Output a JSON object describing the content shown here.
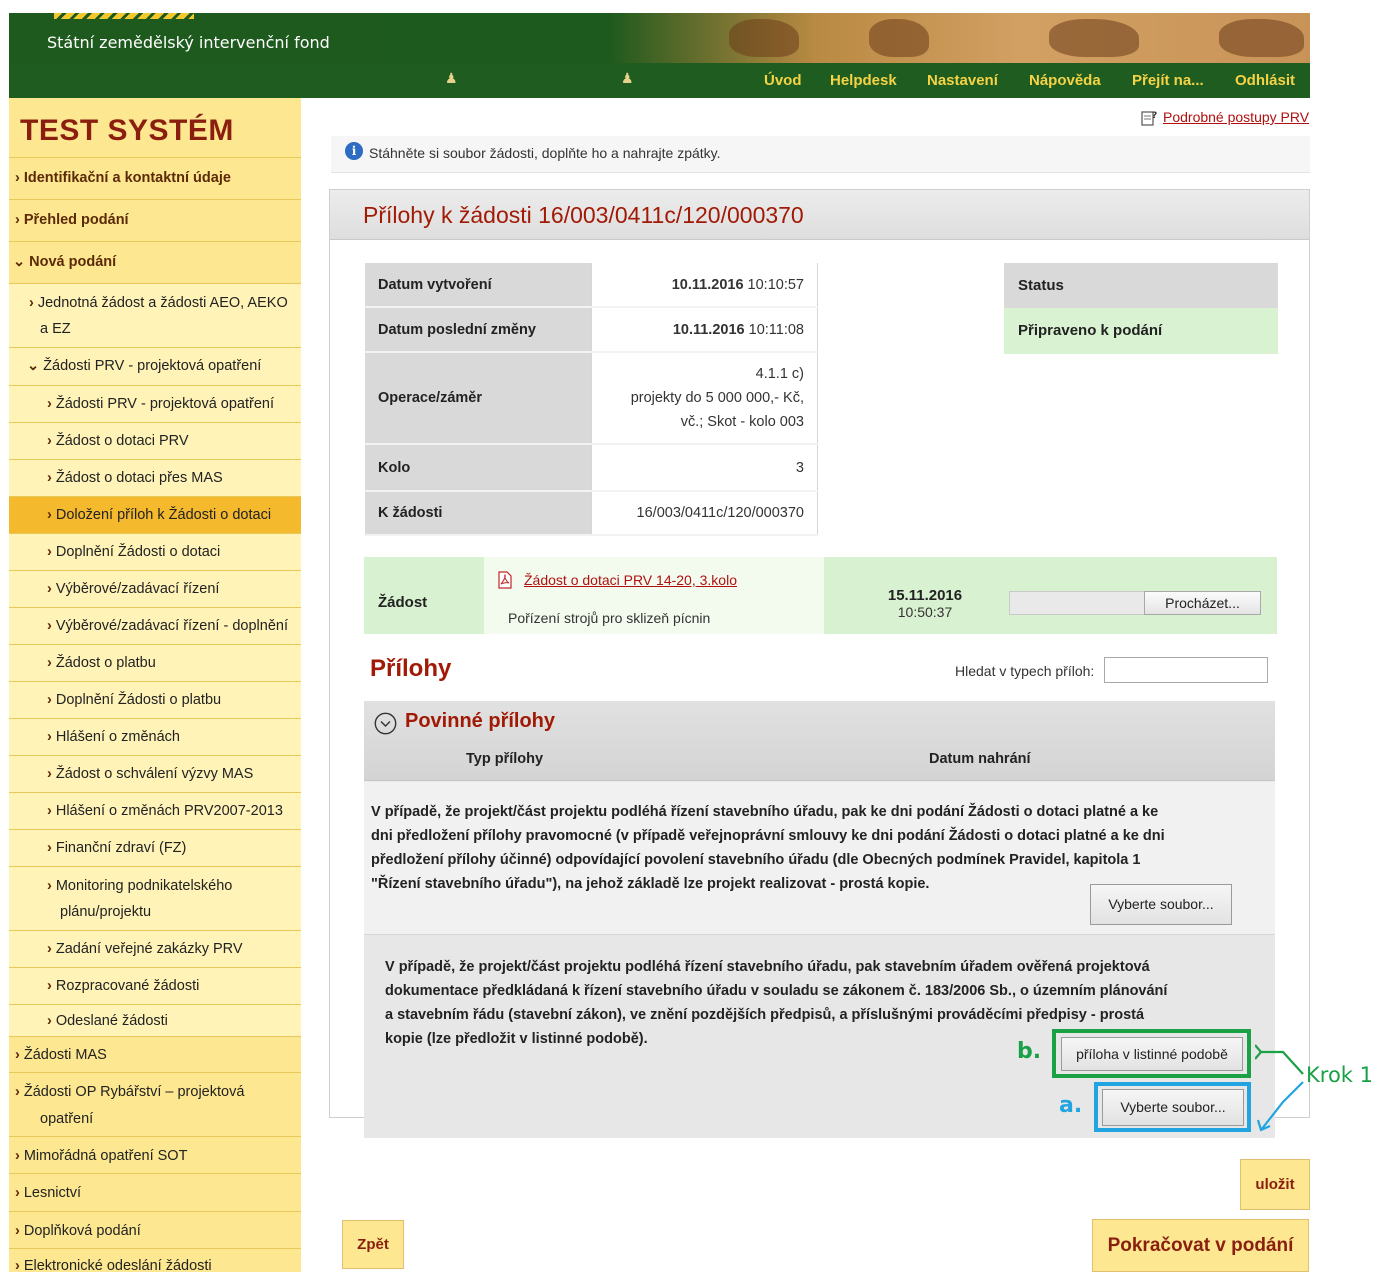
{
  "header": {
    "logo_subtitle": "Státní zemědělský intervenční fond",
    "nav": [
      "Úvod",
      "Helpdesk",
      "Nastavení",
      "Nápověda",
      "Přejít na...",
      "Odhlásit"
    ]
  },
  "sidebar": {
    "system_title": "TEST SYSTÉM",
    "items": [
      {
        "label": "Identifikační a kontaktní údaje"
      },
      {
        "label": "Přehled podání"
      },
      {
        "label": "Nová podání"
      },
      {
        "label_line1": "Jednotná žádost a žádosti AEO, AEKO",
        "label_line2": "a EZ"
      },
      {
        "label": "Žádosti PRV - projektová opatření"
      },
      {
        "label": "Žádosti PRV - projektová opatření"
      },
      {
        "label": "Žádost o dotaci PRV"
      },
      {
        "label": "Žádost o dotaci přes MAS"
      },
      {
        "label": "Doložení příloh k Žádosti o dotaci"
      },
      {
        "label": "Doplnění Žádosti o dotaci"
      },
      {
        "label": "Výběrové/zadávací řízení"
      },
      {
        "label": "Výběrové/zadávací řízení - doplnění"
      },
      {
        "label": "Žádost o platbu"
      },
      {
        "label": "Doplnění Žádosti o platbu"
      },
      {
        "label": "Hlášení o změnách"
      },
      {
        "label": "Žádost o schválení výzvy MAS"
      },
      {
        "label": "Hlášení o změnách PRV2007-2013"
      },
      {
        "label": "Finanční zdraví (FZ)"
      },
      {
        "label_line1": "Monitoring podnikatelského",
        "label_line2": "plánu/projektu"
      },
      {
        "label": "Zadání veřejné zakázky PRV"
      },
      {
        "label": "Rozpracované žádosti"
      },
      {
        "label": "Odeslané žádosti"
      },
      {
        "label": "Žádosti MAS"
      },
      {
        "label_line1": "Žádosti OP Rybářství – projektová",
        "label_line2": "opatření"
      },
      {
        "label": "Mimořádná opatření SOT"
      },
      {
        "label": "Lesnictví"
      },
      {
        "label": "Doplňková podání"
      },
      {
        "label": "Elektronické odeslání žádosti"
      }
    ]
  },
  "help_link": "Podrobné postupy PRV",
  "info_message": "Stáhněte si soubor žádosti, doplňte ho a nahrajte zpátky.",
  "panel_title": "Přílohy k žádosti 16/003/0411c/120/000370",
  "details": {
    "created_label": "Datum vytvoření",
    "created_date": "10.11.2016",
    "created_time": "10:10:57",
    "changed_label": "Datum poslední změny",
    "changed_date": "10.11.2016",
    "changed_time": "10:11:08",
    "operation_label": "Operace/záměr",
    "operation_l1": "4.1.1 c)",
    "operation_l2": "projekty do 5 000 000,- Kč,",
    "operation_l3": "vč.; Skot - kolo 003",
    "round_label": "Kolo",
    "round_value": "3",
    "request_label": "K žádosti",
    "request_value": "16/003/0411c/120/000370"
  },
  "status": {
    "label": "Status",
    "value": "Připraveno k podání"
  },
  "zadost": {
    "label": "Žádost",
    "file_link": "Žádost o dotaci PRV 14-20, 3.kolo",
    "description": "Pořízení strojů pro sklizeň pícnin",
    "date": "15.11.2016",
    "time": "10:50:37",
    "browse_label": "Procházet..."
  },
  "attachments": {
    "title": "Přílohy",
    "search_label": "Hledat v typech příloh:",
    "search_value": "",
    "section_title": "Povinné přílohy",
    "col_type": "Typ přílohy",
    "col_date": "Datum nahrání",
    "row1": {
      "l1": "V případě, že projekt/část projektu podléhá řízení stavebního úřadu, pak ke dni podání Žádosti o dotaci platné a ke",
      "l2": "dni předložení přílohy pravomocné (v případě veřejnoprávní smlouvy ke dni podání Žádosti o dotaci platné a ke dni",
      "l3": "předložení přílohy účinné) odpovídající povolení stavebního úřadu (dle Obecných podmínek Pravidel, kapitola 1",
      "l4": "\"Řízení stavebního úřadu\"), na jehož základě lze projekt realizovat - prostá kopie.",
      "button": "Vyberte soubor..."
    },
    "row2": {
      "l1": "V případě, že projekt/část projektu podléhá řízení stavebního úřadu, pak stavebním úřadem ověřená projektová",
      "l2": "dokumentace předkládaná k řízení stavebního úřadu v souladu se zákonem č. 183/2006 Sb., o územním plánování",
      "l3": "a stavebním řádu (stavební zákon), ve znění pozdějších předpisů, a příslušnými prováděcími předpisy - prostá",
      "l4": "kopie (lze předložit v listinné podobě).",
      "paper_button": "příloha v listinné podobě",
      "file_button": "Vyberte soubor..."
    }
  },
  "annotations": {
    "label_a": "a.",
    "label_b": "b.",
    "step": "Krok 1",
    "color_a": "#22a4e0",
    "color_b": "#1aa145"
  },
  "footer": {
    "save": "uložit",
    "back": "Zpět",
    "continue": "Pokračovat v podání"
  }
}
